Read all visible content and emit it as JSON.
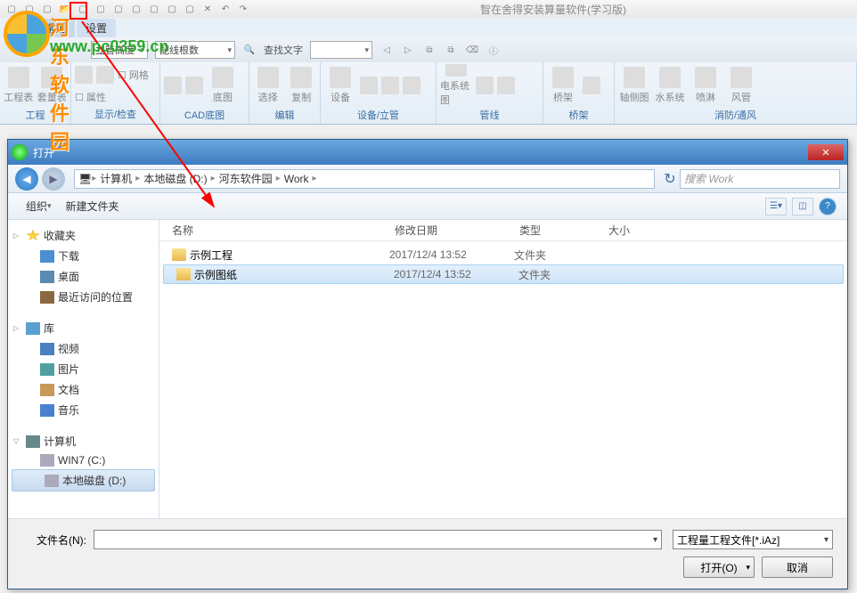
{
  "app": {
    "title": "智在舍得安装算量软件(学习版)"
  },
  "watermark": {
    "text": "河东软件园",
    "url": "www.pc0359.cn"
  },
  "tabs": {
    "common": "常用",
    "settings": "设置"
  },
  "ribbon_ctrl": {
    "combo1": "立管高度",
    "combo2": "配线根数",
    "search_label": "查找文字"
  },
  "ribbon_groups": {
    "g1": "工程",
    "g2": "显示/检查",
    "g3": "CAD底图",
    "g4": "编辑",
    "g5": "设备/立管",
    "g6": "管线",
    "g7": "桥架",
    "g8": "消防/通风"
  },
  "ribbon_buttons": {
    "gcb": "工程表",
    "tlb": "套量表",
    "wg": "网格",
    "sx": "属性",
    "dt": "底图",
    "xz": "选择",
    "fz": "复制",
    "sb": "设备",
    "dxtt": "电系统图",
    "qj": "桥架",
    "zct": "轴侧图",
    "sxt": "水系统",
    "pl": "喷淋",
    "fg": "风管"
  },
  "dialog": {
    "title": "打开",
    "breadcrumb": {
      "computer": "计算机",
      "disk": "本地磁盘 (D:)",
      "folder1": "河东软件园",
      "folder2": "Work"
    },
    "search_placeholder": "搜索 Work",
    "toolbar": {
      "organize": "组织",
      "newfolder": "新建文件夹"
    },
    "columns": {
      "name": "名称",
      "date": "修改日期",
      "type": "类型",
      "size": "大小"
    },
    "sidebar": {
      "favorites": "收藏夹",
      "downloads": "下载",
      "desktop": "桌面",
      "recent": "最近访问的位置",
      "libraries": "库",
      "videos": "视频",
      "pictures": "图片",
      "documents": "文档",
      "music": "音乐",
      "computer": "计算机",
      "diskc": "WIN7 (C:)",
      "diskd": "本地磁盘 (D:)"
    },
    "files": [
      {
        "name": "示例工程",
        "date": "2017/12/4 13:52",
        "type": "文件夹"
      },
      {
        "name": "示例图纸",
        "date": "2017/12/4 13:52",
        "type": "文件夹"
      }
    ],
    "footer": {
      "filename_label": "文件名(N):",
      "filename_value": "",
      "filter": "工程量工程文件[*.iAz]",
      "open": "打开(O)",
      "cancel": "取消"
    }
  }
}
